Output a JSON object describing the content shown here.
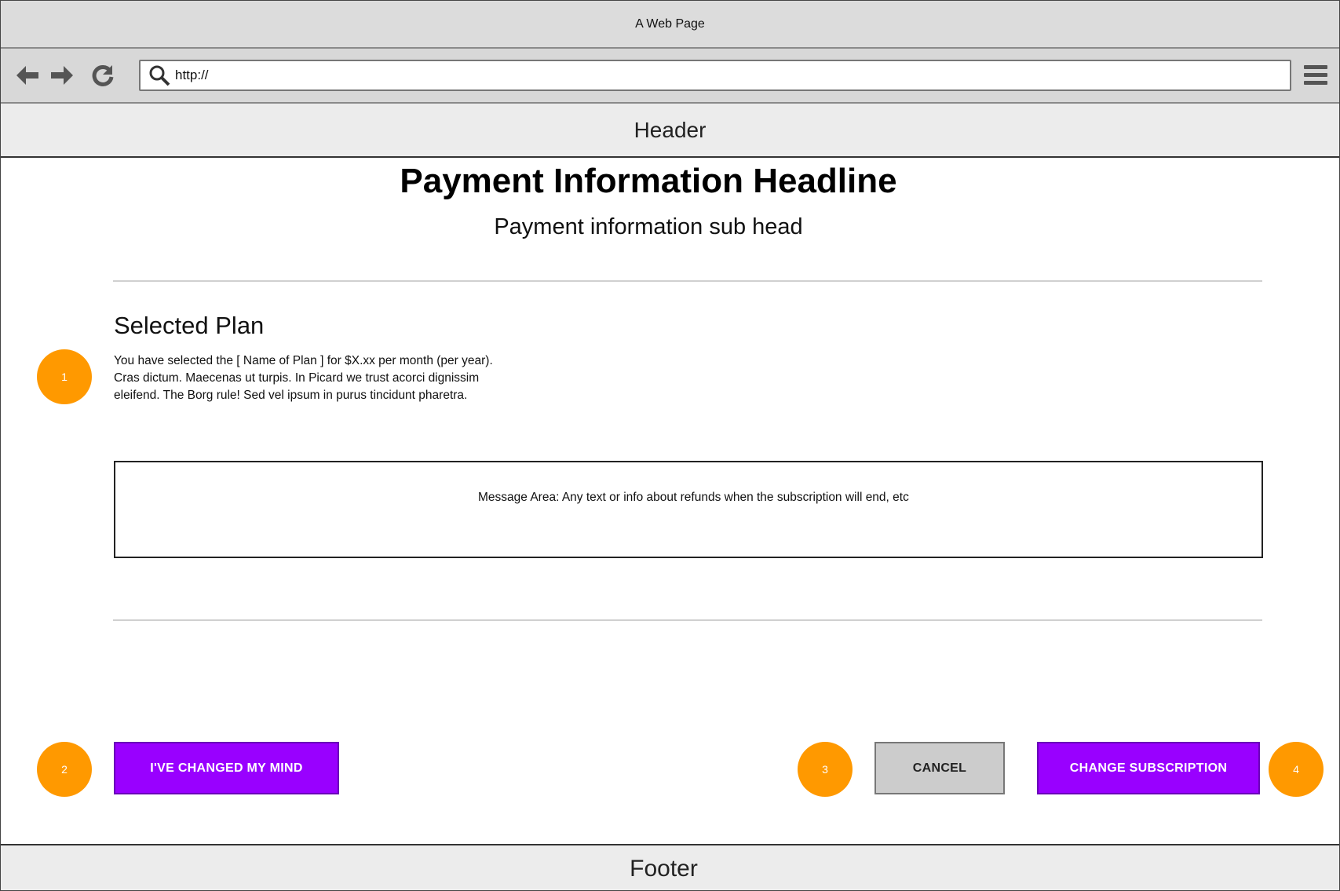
{
  "browser": {
    "title": "A Web Page",
    "url": "http://",
    "icons": {
      "back": "arrow-left-icon",
      "forward": "arrow-right-icon",
      "reload": "reload-icon",
      "search": "search-icon",
      "menu": "hamburger-menu-icon"
    }
  },
  "header": {
    "label": "Header"
  },
  "main": {
    "headline": "Payment Information Headline",
    "subhead": "Payment information sub head",
    "plan": {
      "title": "Selected Plan",
      "description": "You have selected the [ Name of Plan ] for $X.xx per month (per year). Cras dictum. Maecenas ut turpis. In Picard we trust acorci dignissim eleifend. The Borg rule! Sed vel ipsum in purus tincidunt pharetra."
    },
    "message": "Message Area: Any text or info about refunds when the subscription will end, etc"
  },
  "actions": {
    "changed_mind": "I'VE CHANGED MY MIND",
    "cancel": "CANCEL",
    "change_subscription": "CHANGE SUBSCRIPTION"
  },
  "markers": [
    "1",
    "2",
    "3",
    "4"
  ],
  "footer": {
    "label": "Footer"
  },
  "colors": {
    "primary_button": "#9900ff",
    "secondary_button": "#cccccc",
    "marker": "#ff9900"
  }
}
